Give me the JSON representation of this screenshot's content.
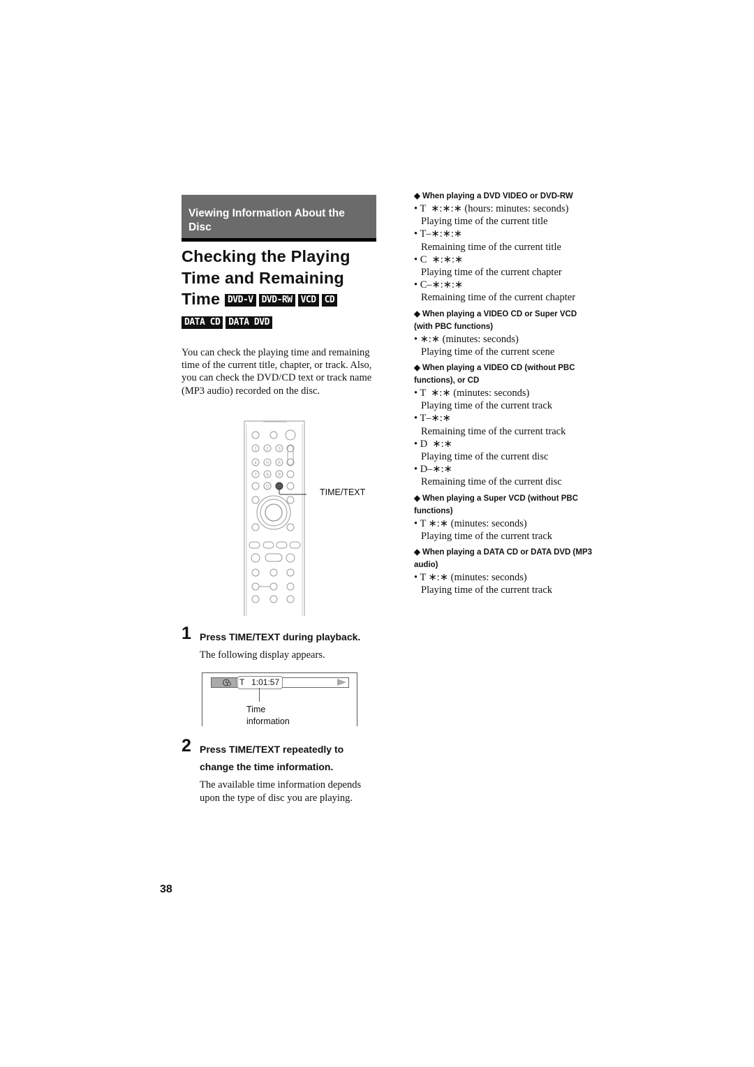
{
  "section_header": "Viewing Information About the Disc",
  "title": {
    "line1": "Checking the Playing",
    "line2": "Time and Remaining",
    "line3": "Time",
    "badges": [
      "DVD-V",
      "DVD-RW",
      "VCD",
      "CD",
      "DATA CD",
      "DATA DVD"
    ]
  },
  "intro": "You can check the playing time and remaining time of the current title, chapter, or track. Also, you can check the DVD/CD text or track name (MP3 audio) recorded on the disc.",
  "remote": {
    "callout_label": "TIME/TEXT",
    "number_keys": [
      "1",
      "2",
      "3",
      "4",
      "5",
      "6",
      "7",
      "8",
      "9",
      "0"
    ],
    "plus_label": "+",
    "minus_label": "−"
  },
  "steps": [
    {
      "number": "1",
      "heading": "Press TIME/TEXT during playback.",
      "body": "The following display appears."
    },
    {
      "number": "2",
      "heading_line1": "Press TIME/TEXT repeatedly to",
      "heading_line2": "change the time information.",
      "body": "The available time information depends upon the type of disc you are playing."
    }
  ],
  "display": {
    "time_readout": "T   1:01:57",
    "caption_line1": "Time",
    "caption_line2": "information"
  },
  "right_column": [
    {
      "heading": "◆ When playing a DVD VIDEO or DVD-RW",
      "items": [
        {
          "code": "• T  ∗:∗:∗ (hours: minutes: seconds)",
          "desc": "Playing time of the current title"
        },
        {
          "code": "• T–∗:∗:∗",
          "desc": "Remaining time of the current title"
        },
        {
          "code": "• C  ∗:∗:∗",
          "desc": "Playing time of the current chapter"
        },
        {
          "code": "• C–∗:∗:∗",
          "desc": "Remaining time of the current chapter"
        }
      ]
    },
    {
      "heading": "◆ When playing a VIDEO CD or Super VCD (with PBC functions)",
      "items": [
        {
          "code": "• ∗:∗ (minutes: seconds)",
          "desc": "Playing time of the current scene"
        }
      ]
    },
    {
      "heading": "◆ When playing a VIDEO CD (without PBC functions), or CD",
      "items": [
        {
          "code": "• T  ∗:∗ (minutes: seconds)",
          "desc": "Playing time of the current track"
        },
        {
          "code": "• T–∗:∗",
          "desc": "Remaining time of the current track"
        },
        {
          "code": "• D  ∗:∗",
          "desc": "Playing time of the current disc"
        },
        {
          "code": "• D–∗:∗",
          "desc": "Remaining time of the current disc"
        }
      ]
    },
    {
      "heading": "◆ When playing a Super VCD (without PBC functions)",
      "items": [
        {
          "code": "• T ∗:∗ (minutes: seconds)",
          "desc": "Playing time of the current track"
        }
      ]
    },
    {
      "heading": "◆ When playing a DATA CD or DATA DVD (MP3 audio)",
      "items": [
        {
          "code": "• T ∗:∗ (minutes: seconds)",
          "desc": "Playing time of the current track"
        }
      ]
    }
  ],
  "page_number": "38"
}
